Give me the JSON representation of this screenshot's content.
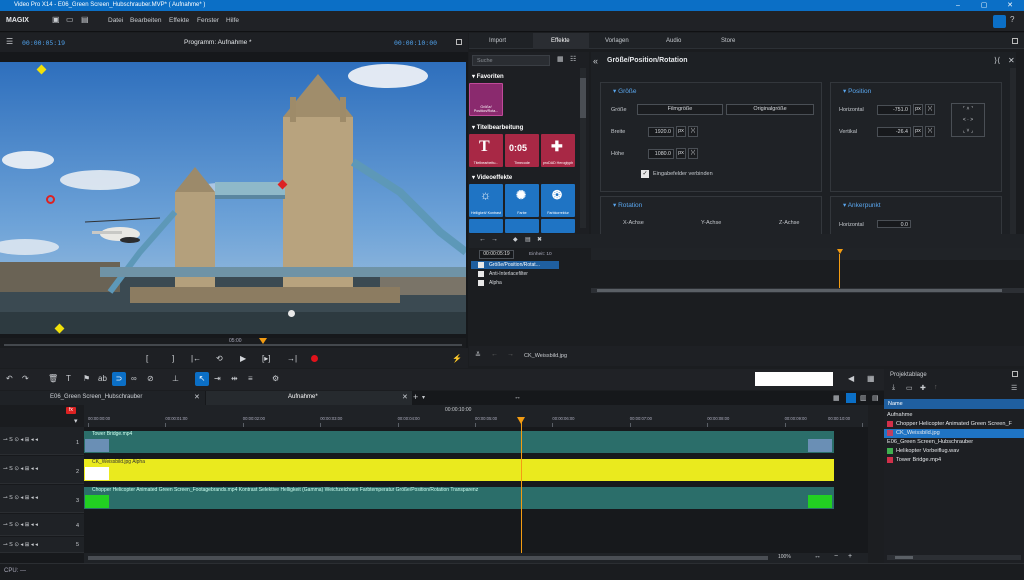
{
  "window": {
    "title": "Video Pro X14 - E06_Green Screen_Hubschrauber.MVP* ( Aufnahme* )"
  },
  "menu": {
    "brand": "MAGIX",
    "items": [
      "Datei",
      "Bearbeiten",
      "Effekte",
      "Fenster",
      "Hilfe"
    ]
  },
  "monitor": {
    "current_time": "00:00:05:19",
    "title": "Programm: Aufnahme *",
    "total_time": "00:00:10:00",
    "ruler_mark": "05:00"
  },
  "media_tabs": [
    "Import",
    "Effekte",
    "Vorlagen",
    "Audio",
    "Store"
  ],
  "effects": {
    "search_placeholder": "Suche",
    "categories": {
      "favorites": "Favoriten",
      "titles": "Titelbearbeitung",
      "video": "Videoeffekte"
    },
    "favorite_tiles": [
      "Größe/ Position/Rota..."
    ],
    "title_tiles": [
      "Titelbearbeitu...",
      "Timecode",
      "proDAD Heroglyph"
    ],
    "video_tiles": [
      "Helligkeit/ Kontrast",
      "Farbe",
      "Farbkorrektur"
    ]
  },
  "properties": {
    "title": "Größe/Position/Rotation",
    "size": {
      "title": "Größe",
      "label_size": "Größe",
      "btn_film": "Filmgröße",
      "btn_original": "Originalgröße",
      "label_width": "Breite",
      "width": "1920.0",
      "label_height": "Höhe",
      "height": "1080.0",
      "unit": "px",
      "link_label": "Eingabefelder verbinden"
    },
    "position": {
      "title": "Position",
      "label_h": "Horizontal",
      "h": "-751.0",
      "label_v": "Vertikal",
      "v": "-26.4",
      "unit": "px"
    },
    "rotation": {
      "title": "Rotation",
      "x": "X-Achse",
      "y": "Y-Achse",
      "z": "Z-Achse"
    },
    "anchor": {
      "title": "Ankerpunkt",
      "label_h": "Horizontal",
      "h": "0.0"
    }
  },
  "keyframes": {
    "time": "00:00:05:19",
    "unit": "Einheit: 10",
    "rows": [
      "Größe/Position/Rotat...",
      "Anti-Interlacefilter",
      "Alpha"
    ],
    "clip_name": "CK_Weissbild.jpg"
  },
  "timeline": {
    "tabs": [
      "E06_Green Screen_Hubschrauber",
      "Aufnahme*"
    ],
    "ruler_top": "00:00:10:00",
    "ruler_ticks": [
      "00:00:00:00",
      "00:00:01:00",
      "00:00:02:00",
      "00:00:03:00",
      "00:00:04:00",
      "00:00:05:00",
      "00:00:06:00",
      "00:00:07:00",
      "00:00:08:00",
      "00:00:09:00",
      "00:00:10:00"
    ],
    "tracks": [
      {
        "num": "1",
        "clip": "Tower Bridge.mp4"
      },
      {
        "num": "2",
        "clip": "CK_Weissbild.jpg Alpha"
      },
      {
        "num": "3",
        "clip": "Chopper Helicopter Animated Green Screen_Footagebrands.mp4  Kontrast  Selektive Helligkeit (Gamma)  Weichzeichnen  Farbtemperatur  Größe/Position/Rotation  Transparenz"
      },
      {
        "num": "4",
        "clip": ""
      },
      {
        "num": "5",
        "clip": ""
      }
    ],
    "zoom": "100%",
    "playhead_fraction": 0.56
  },
  "project": {
    "title": "Projektablage",
    "col_name": "Name",
    "group": "Aufnahme",
    "items": [
      {
        "name": "Chopper Helicopter Animated Green Screen_F",
        "color": "#d0304a",
        "selected": false
      },
      {
        "name": "CK_Weissbild.jpg",
        "color": "#c04060",
        "selected": true
      },
      {
        "name": "E06_Green Screen_Hubschrauber",
        "color": "",
        "selected": false
      },
      {
        "name": "Helikopter Vorbeiflug.wav",
        "color": "#40b050",
        "selected": false
      },
      {
        "name": "Tower Bridge.mp4",
        "color": "#d0304a",
        "selected": false
      }
    ]
  },
  "status": {
    "cpu": "CPU: —"
  }
}
